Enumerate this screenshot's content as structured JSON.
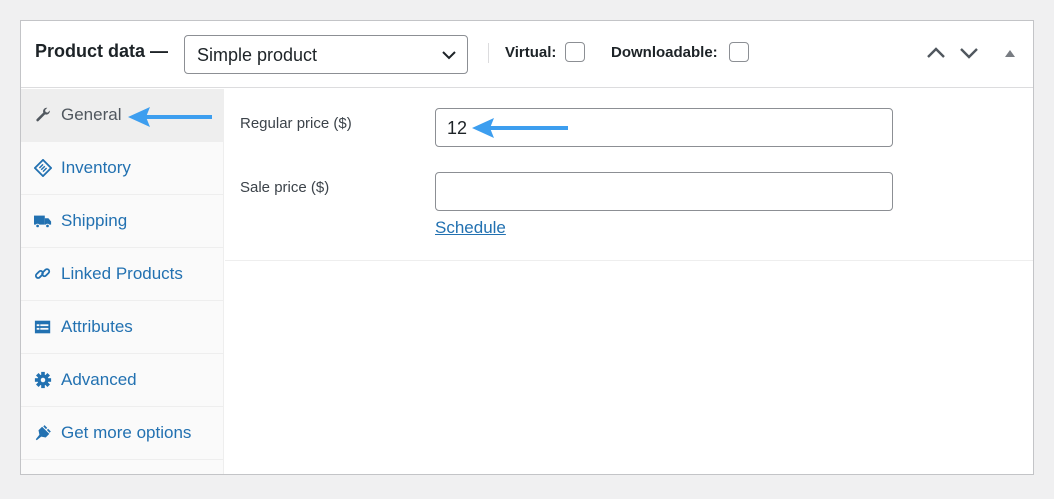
{
  "header": {
    "title": "Product data —",
    "product_type": "Simple product",
    "virtual_label": "Virtual:",
    "downloadable_label": "Downloadable:"
  },
  "tabs": [
    {
      "label": "General",
      "icon": "wrench-icon"
    },
    {
      "label": "Inventory",
      "icon": "tag-icon"
    },
    {
      "label": "Shipping",
      "icon": "truck-icon"
    },
    {
      "label": "Linked Products",
      "icon": "link-icon"
    },
    {
      "label": "Attributes",
      "icon": "list-icon"
    },
    {
      "label": "Advanced",
      "icon": "gear-icon"
    },
    {
      "label": "Get more options",
      "icon": "plugin-icon"
    }
  ],
  "fields": {
    "regular_price_label": "Regular price ($)",
    "regular_price_value": "12",
    "sale_price_label": "Sale price ($)",
    "sale_price_value": "",
    "schedule_link": "Schedule"
  },
  "colors": {
    "link": "#2271b1",
    "annotation_arrow": "#3d9eef"
  }
}
